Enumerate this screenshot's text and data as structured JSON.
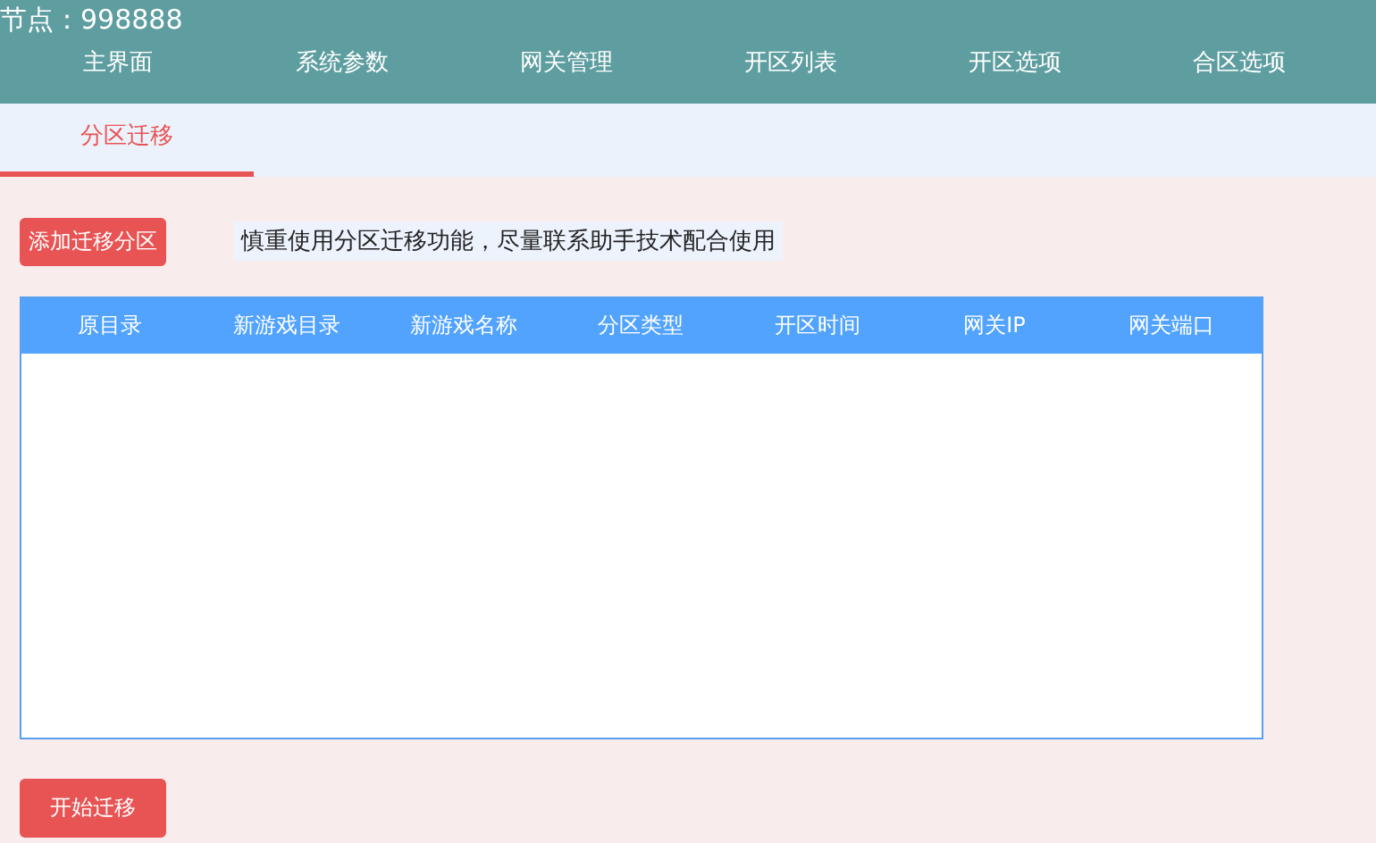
{
  "header": {
    "node_label": "节点：998888",
    "nav": [
      "主界面",
      "系统参数",
      "网关管理",
      "开区列表",
      "开区选项",
      "合区选项"
    ]
  },
  "subtabs": [
    {
      "label": "分区迁移",
      "selected": true
    }
  ],
  "add_button": "添加迁移分区",
  "notice": "慎重使用分区迁移功能，尽量联系助手技术配合使用",
  "table": {
    "columns": [
      "原目录",
      "新游戏目录",
      "新游戏名称",
      "分区类型",
      "开区时间",
      "网关IP",
      "网关端口"
    ]
  },
  "start_button": "开始迁移"
}
